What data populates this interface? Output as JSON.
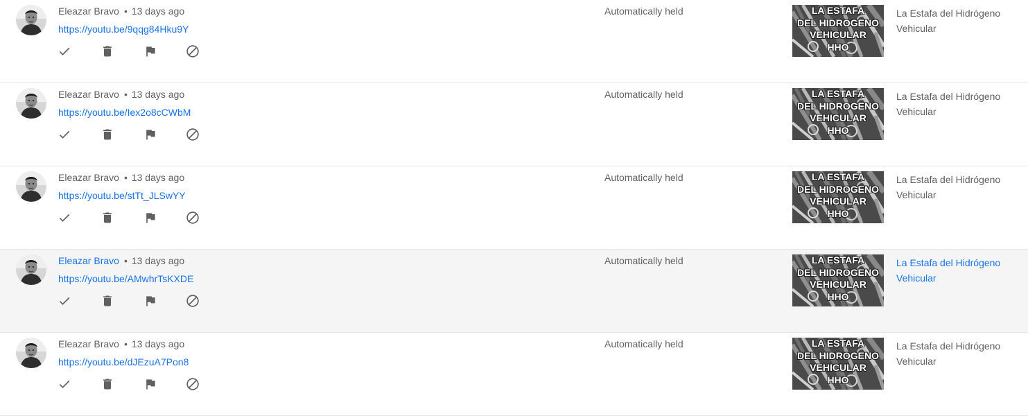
{
  "comments": [
    {
      "author": "Eleazar Bravo",
      "separator": "•",
      "time": "13 days ago",
      "link": "https://youtu.be/9qqg84Hku9Y",
      "status": "Automatically held",
      "thumb_lines": [
        "LA ESTAFA",
        "DEL HIDROGENO",
        "VEHICULAR",
        "HHO"
      ],
      "video_title": "La Estafa del Hidrógeno Vehicular",
      "hovered": false
    },
    {
      "author": "Eleazar Bravo",
      "separator": "•",
      "time": "13 days ago",
      "link": "https://youtu.be/Iex2o8cCWbM",
      "status": "Automatically held",
      "thumb_lines": [
        "LA ESTAFA",
        "DEL HIDROGENO",
        "VEHICULAR",
        "HHO"
      ],
      "video_title": "La Estafa del Hidrógeno Vehicular",
      "hovered": false
    },
    {
      "author": "Eleazar Bravo",
      "separator": "•",
      "time": "13 days ago",
      "link": "https://youtu.be/stTt_JLSwYY",
      "status": "Automatically held",
      "thumb_lines": [
        "LA ESTAFA",
        "DEL HIDROGENO",
        "VEHICULAR",
        "HHO"
      ],
      "video_title": "La Estafa del Hidrógeno Vehicular",
      "hovered": false
    },
    {
      "author": "Eleazar Bravo",
      "separator": "•",
      "time": "13 days ago",
      "link": "https://youtu.be/AMwhrTsKXDE",
      "status": "Automatically held",
      "thumb_lines": [
        "LA ESTAFA",
        "DEL HIDROGENO",
        "VEHICULAR",
        "HHO"
      ],
      "video_title": "La Estafa del Hidrógeno Vehicular",
      "hovered": true
    },
    {
      "author": "Eleazar Bravo",
      "separator": "•",
      "time": "13 days ago",
      "link": "https://youtu.be/dJEzuA7Pon8",
      "status": "Automatically held",
      "thumb_lines": [
        "LA ESTAFA",
        "DEL HIDROGENO",
        "VEHICULAR",
        "HHO"
      ],
      "video_title": "La Estafa del Hidrógeno Vehicular",
      "hovered": false
    }
  ],
  "actions": [
    {
      "icon": "checkmark-icon",
      "name": "approve-button"
    },
    {
      "icon": "trash-icon",
      "name": "remove-button"
    },
    {
      "icon": "flag-icon",
      "name": "report-button"
    },
    {
      "icon": "block-icon",
      "name": "hide-user-button"
    }
  ],
  "colors": {
    "text": "#606060",
    "link": "#1a73e8",
    "icon": "#606060",
    "divider": "#e5e5e5",
    "hover_row": "#f5f5f5"
  }
}
